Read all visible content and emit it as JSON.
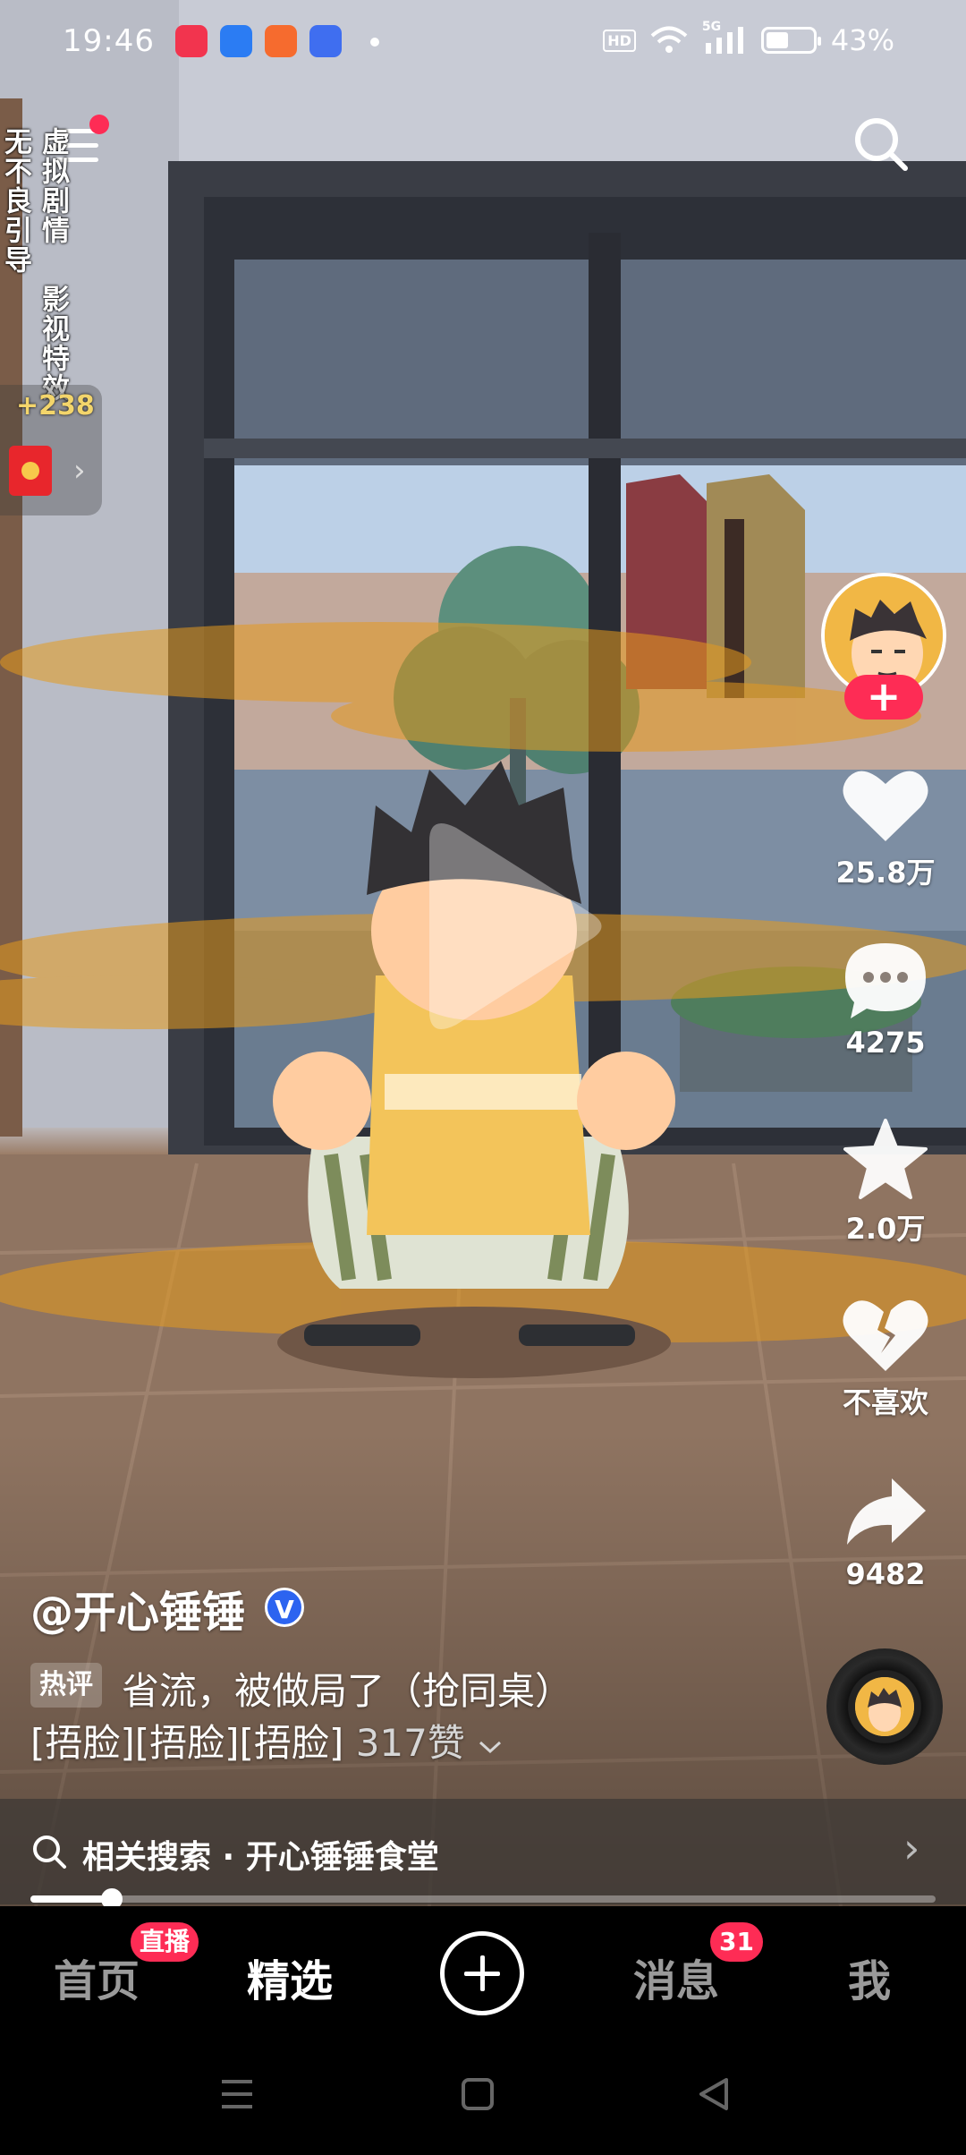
{
  "status_bar": {
    "time": "19:46",
    "hd": "HD",
    "signal": "5G",
    "battery": "43%",
    "app_icon_colors": [
      "#f2344e",
      "#2b7cf3",
      "#f66b2e",
      "#3f6ef0"
    ]
  },
  "top": {
    "menu_icon": "hamburger-menu-icon",
    "search_icon": "search-icon",
    "disclaimer_col1": "无不良引导",
    "disclaimer_col2": "虚拟剧情",
    "disclaimer_col3": "影视特效"
  },
  "red_packet": {
    "count": "+238"
  },
  "rail": {
    "follow_symbol": "+",
    "like_count": "25.8万",
    "comment_count": "4275",
    "favorite_count": "2.0万",
    "dislike_label": "不喜欢",
    "share_count": "9482"
  },
  "video": {
    "author": "@开心锤锤",
    "verified_mark": "V",
    "hot_comment_tag": "热评",
    "hot_comment_text": "省流，被做局了（抢同桌）",
    "hot_comment_line2": "[捂脸][捂脸][捂脸]",
    "hot_comment_likes": "317赞",
    "related_search": "相关搜索 · 开心锤锤食堂",
    "progress": 0.09
  },
  "tabbar": {
    "home": "首页",
    "live_badge": "直播",
    "featured": "精选",
    "messages": "消息",
    "messages_badge": "31",
    "me": "我"
  },
  "colors": {
    "accent": "#fe2c55",
    "verified": "#2c64f0"
  }
}
